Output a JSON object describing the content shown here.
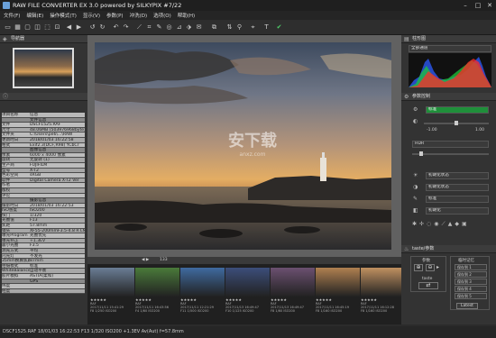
{
  "window": {
    "title": "RAW FILE CONVERTER EX 3.0 powered by SILKYPIX  #7/22",
    "minimize": "–",
    "maximize": "□",
    "close": "✕"
  },
  "menu": [
    "文件(F)",
    "编辑(E)",
    "操作模式(T)",
    "显示(V)",
    "参数(P)",
    "冲洗(D)",
    "选项(O)",
    "帮助(H)"
  ],
  "left_panel": {
    "navigator_title": "导航器",
    "info_header": {
      "key": "项目名称",
      "value": "信息"
    },
    "rows": [
      {
        "type": "sec",
        "k": "",
        "v": "文件信息"
      },
      {
        "type": "odd",
        "k": "文件",
        "v": "DSCF1525.RAF"
      },
      {
        "type": "even",
        "k": "尺寸",
        "v": "48.06MB (503976968byte)"
      },
      {
        "type": "odd",
        "k": "文件夹",
        "v": "C:\\Users\\pe6\\...\\RAW"
      },
      {
        "type": "even",
        "k": "更新时日",
        "v": "2018/01/03 16:22:58"
      },
      {
        "type": "odd",
        "k": "格式",
        "v": "Exif2.3(DCF,R98) YCbCr"
      },
      {
        "type": "sec",
        "k": "",
        "v": "图像信息"
      },
      {
        "type": "odd",
        "k": "像素",
        "v": "6000 x 4000 像素"
      },
      {
        "type": "even",
        "k": "旋转",
        "v": "无旋转 (1)"
      },
      {
        "type": "odd",
        "k": "生产商",
        "v": "FUJIFILM"
      },
      {
        "type": "even",
        "k": "型号",
        "v": "X-T2"
      },
      {
        "type": "odd",
        "k": "色彩空间",
        "v": "sRGB"
      },
      {
        "type": "even",
        "k": "软件",
        "v": "Digital Camera X-T2 Ver"
      },
      {
        "type": "odd",
        "k": "作者",
        "v": ""
      },
      {
        "type": "even",
        "k": "版权",
        "v": ""
      },
      {
        "type": "odd",
        "k": "评论",
        "v": ""
      },
      {
        "type": "sec",
        "k": "",
        "v": "摄影信息"
      },
      {
        "type": "odd",
        "k": "摄影时日",
        "v": "2018/01/03 16:22:53"
      },
      {
        "type": "even",
        "k": "ISO感度",
        "v": "ISO200"
      },
      {
        "type": "odd",
        "k": "快门",
        "v": "1/320"
      },
      {
        "type": "even",
        "k": "光圈值",
        "v": "F13"
      },
      {
        "type": "odd",
        "k": "焦距",
        "v": "57.8mm"
      },
      {
        "type": "even",
        "k": "镜头",
        "v": "XF55-200mmF3.5-4.8 R LM OIS"
      },
      {
        "type": "odd",
        "k": "曝光Program",
        "v": "光圈优先"
      },
      {
        "type": "even",
        "k": "曝光补正",
        "v": "+1.3EV"
      },
      {
        "type": "odd",
        "k": "最小光圈",
        "v": "F3.5"
      },
      {
        "type": "even",
        "k": "测光方式",
        "v": "平均"
      },
      {
        "type": "odd",
        "k": "闪光灯",
        "v": "不发光"
      },
      {
        "type": "even",
        "k": "35mm换算焦距",
        "v": "87mm"
      },
      {
        "type": "odd",
        "k": "拍摄模式",
        "v": "标准"
      },
      {
        "type": "even",
        "k": "WhiteBalance",
        "v": "自动平衡"
      },
      {
        "type": "odd",
        "k": "胶片模拟",
        "v": "ASTIA(柔和)"
      },
      {
        "type": "sec",
        "k": "",
        "v": "GPS"
      },
      {
        "type": "odd",
        "k": "纬度",
        "v": ""
      },
      {
        "type": "even",
        "k": "经度",
        "v": ""
      }
    ]
  },
  "viewer": {
    "zoom_label": "133",
    "watermark_text": "安下载",
    "watermark_sub": "anxz.com"
  },
  "filmstrip": [
    {
      "stars": "★★★★★",
      "badge": "RAF",
      "date": "2017/11/11 15:41:29",
      "exp": "F8 1/250 ISO200",
      "color": "#6a7d95"
    },
    {
      "stars": "★★★★★",
      "badge": "RAF",
      "date": "2017/11/11 16:43:56",
      "exp": "F4 1/60 ISO200",
      "color": "#4a7a3a"
    },
    {
      "stars": "★★★★★",
      "badge": "RAF",
      "date": "2017/11/11 12:21:29",
      "exp": "F11 1/500 ISO200",
      "color": "#3f6aa0"
    },
    {
      "stars": "★★★★★",
      "badge": "RAF",
      "date": "2017/11/13 16:49:47",
      "exp": "F10 1/125 ISO200",
      "color": "#3c4e7a"
    },
    {
      "stars": "★★★★★",
      "badge": "RAF",
      "date": "2017/11/13 16:49:47",
      "exp": "F8 1/60 ISO200",
      "color": "#6b5070"
    },
    {
      "stars": "★★★★★",
      "badge": "RAF",
      "date": "2017/11/11 16:45:19",
      "exp": "F8 1/160 ISO200",
      "color": "#b08050"
    },
    {
      "stars": "★★★★★",
      "badge": "RAF",
      "date": "2017/11/11 16:12:28",
      "exp": "F8 1/160 ISO200",
      "color": "#c09060"
    }
  ],
  "status_bar": "DSCF1525.RAF 18/01/03 16:22:53 F13 1/320 ISO200 +1.3EV Av(Aut) f=57.8mm",
  "right_panel": {
    "histogram_title": "柱形图",
    "histogram_channel": "全部通道",
    "params_title": "参数控制",
    "preset_value": "标准",
    "exposure_min": "-1.00",
    "exposure_max": "1.00",
    "hdr_label": "HDR",
    "hdr_value": "标准",
    "wb_label": "初期化状态",
    "tone_label": "初期化状态",
    "color_label": "标准",
    "sharp_label": "初期化",
    "taste_title": "taste/参数",
    "params_label": "参数",
    "taste_label": "taste",
    "temp_params_title": "临时记忆",
    "temp_items": [
      "保存到 1",
      "保存到 2",
      "保存到 3",
      "保存到 4",
      "保存到 5"
    ],
    "latest_label": "Latest"
  },
  "colors": {
    "accent_green": "#1f8f3a",
    "panel_bg": "#333333"
  }
}
